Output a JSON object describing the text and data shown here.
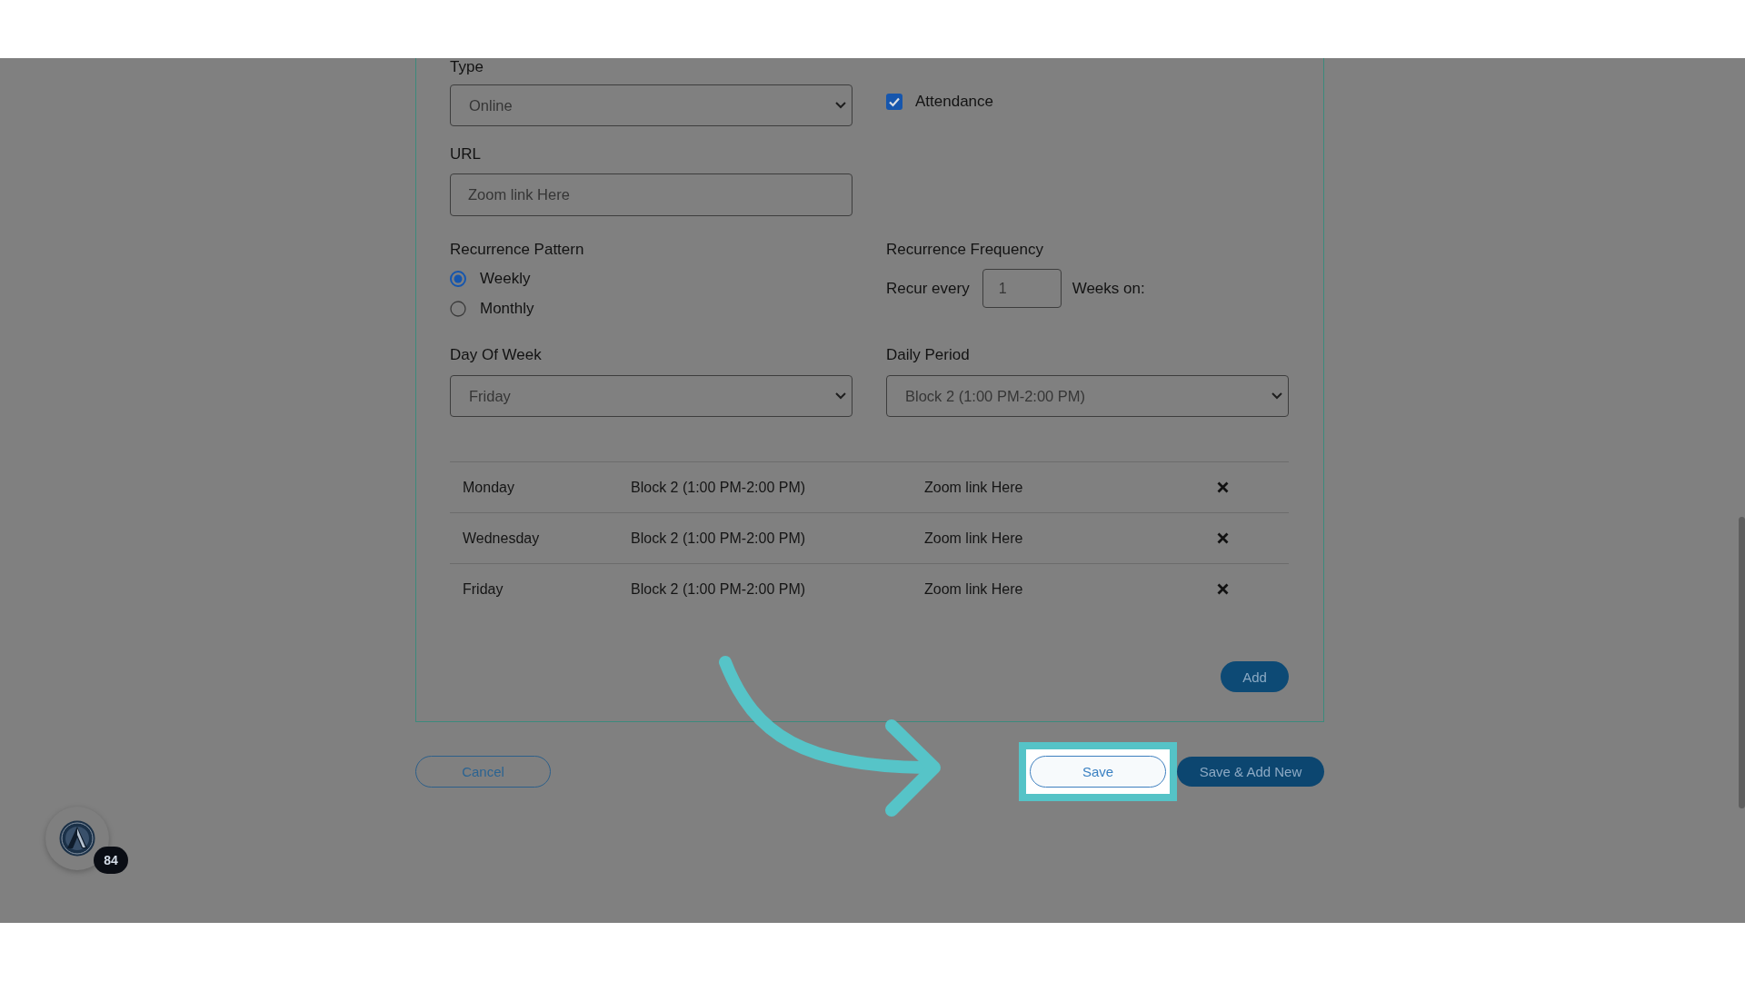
{
  "form": {
    "type": {
      "label": "Type",
      "value": "Online"
    },
    "attendance": {
      "label": "Attendance",
      "checked": true
    },
    "url": {
      "label": "URL",
      "value": "Zoom link Here"
    },
    "recurrence_pattern": {
      "label": "Recurrence Pattern",
      "options": [
        {
          "label": "Weekly",
          "selected": true
        },
        {
          "label": "Monthly",
          "selected": false
        }
      ]
    },
    "recurrence_frequency": {
      "label": "Recurrence Frequency",
      "prefix": "Recur every",
      "value": "1",
      "suffix": "Weeks on:"
    },
    "day_of_week": {
      "label": "Day Of Week",
      "value": "Friday"
    },
    "daily_period": {
      "label": "Daily Period",
      "value": "Block 2 (1:00 PM-2:00 PM)"
    }
  },
  "schedule": {
    "rows": [
      {
        "day": "Monday",
        "period": "Block 2 (1:00 PM-2:00 PM)",
        "url": "Zoom link Here"
      },
      {
        "day": "Wednesday",
        "period": "Block 2 (1:00 PM-2:00 PM)",
        "url": "Zoom link Here"
      },
      {
        "day": "Friday",
        "period": "Block 2 (1:00 PM-2:00 PM)",
        "url": "Zoom link Here"
      }
    ],
    "add_button": "Add"
  },
  "buttons": [
    {
      "label": "Cancel",
      "kind": "outline",
      "highlighted": false
    },
    {
      "label": "Save",
      "kind": "outline",
      "highlighted": true
    },
    {
      "label": "Save & Add New",
      "kind": "primary",
      "highlighted": false
    }
  ],
  "avatar": {
    "badge": "84"
  }
}
